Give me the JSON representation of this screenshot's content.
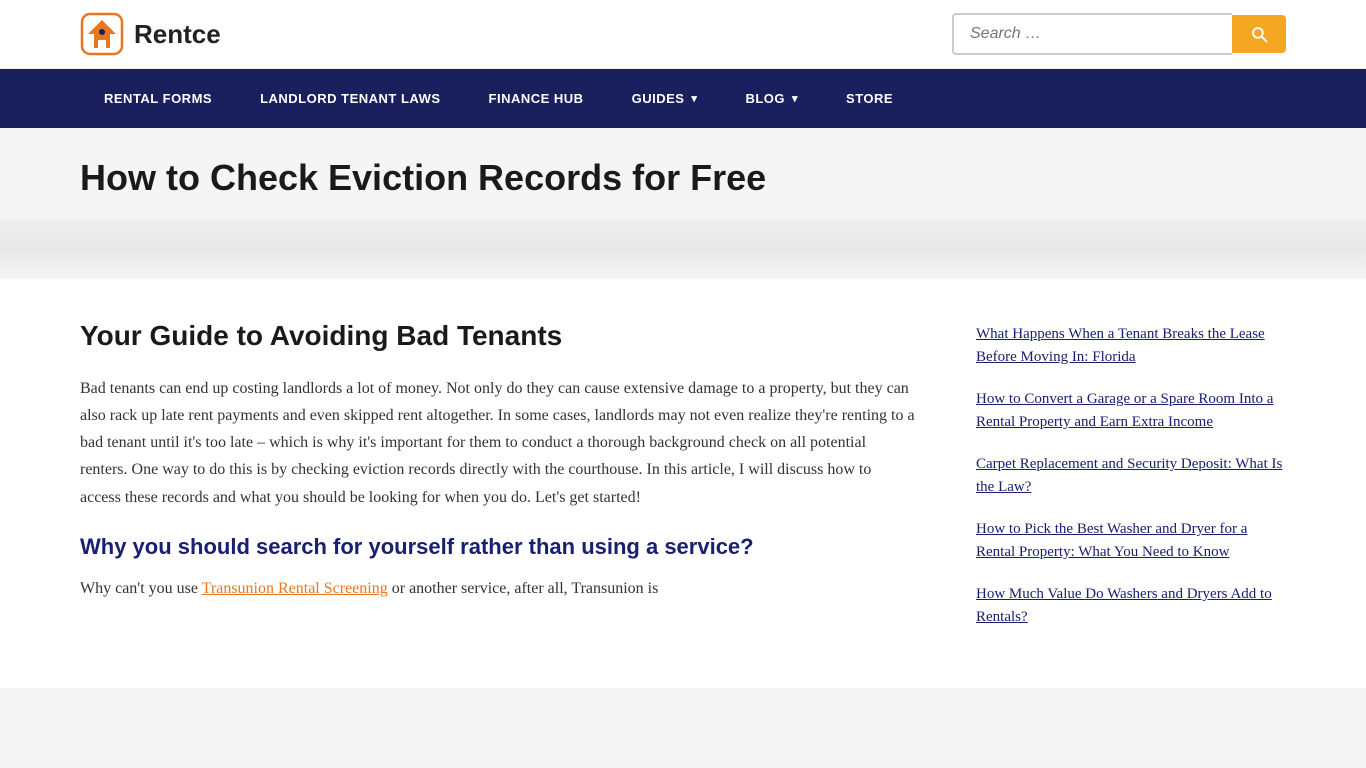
{
  "header": {
    "logo_text": "Rentce",
    "search_placeholder": "Search …",
    "search_button_label": "Search"
  },
  "nav": {
    "items": [
      {
        "label": "RENTAL FORMS",
        "has_dropdown": false
      },
      {
        "label": "LANDLORD TENANT LAWS",
        "has_dropdown": false
      },
      {
        "label": "FINANCE HUB",
        "has_dropdown": false
      },
      {
        "label": "GUIDES",
        "has_dropdown": true
      },
      {
        "label": "BLOG",
        "has_dropdown": true
      },
      {
        "label": "STORE",
        "has_dropdown": false
      }
    ]
  },
  "page": {
    "title": "How to Check Eviction Records for Free"
  },
  "article": {
    "section_heading": "Your Guide to Avoiding Bad Tenants",
    "body_paragraph": "Bad tenants can end up costing landlords a lot of money. Not only do they can cause extensive damage to a property, but they can also rack up late rent payments and even skipped rent altogether. In some cases, landlords may not even realize they're renting to a bad tenant until it's too late – which is why it's important for them to conduct a thorough background check on all potential renters. One way to do this is by checking eviction records directly with the courthouse. In this article, I will discuss how to access these records and what you should be looking for when you do. Let's get started!",
    "subheading": "Why you should search for yourself rather than using a service?",
    "subparagraph_start": "Why can't you use ",
    "subparagraph_link_text": "Transunion Rental Screening",
    "subparagraph_end": " or another service, after all, Transunion is"
  },
  "sidebar": {
    "links": [
      "What Happens When a Tenant Breaks the Lease Before Moving In: Florida",
      "How to Convert a Garage or a Spare Room Into a Rental Property and Earn Extra Income",
      "Carpet Replacement and Security Deposit: What Is the Law?",
      "How to Pick the Best Washer and Dryer for a Rental Property: What You Need to Know",
      "How Much Value Do Washers and Dryers Add to Rentals?"
    ]
  }
}
